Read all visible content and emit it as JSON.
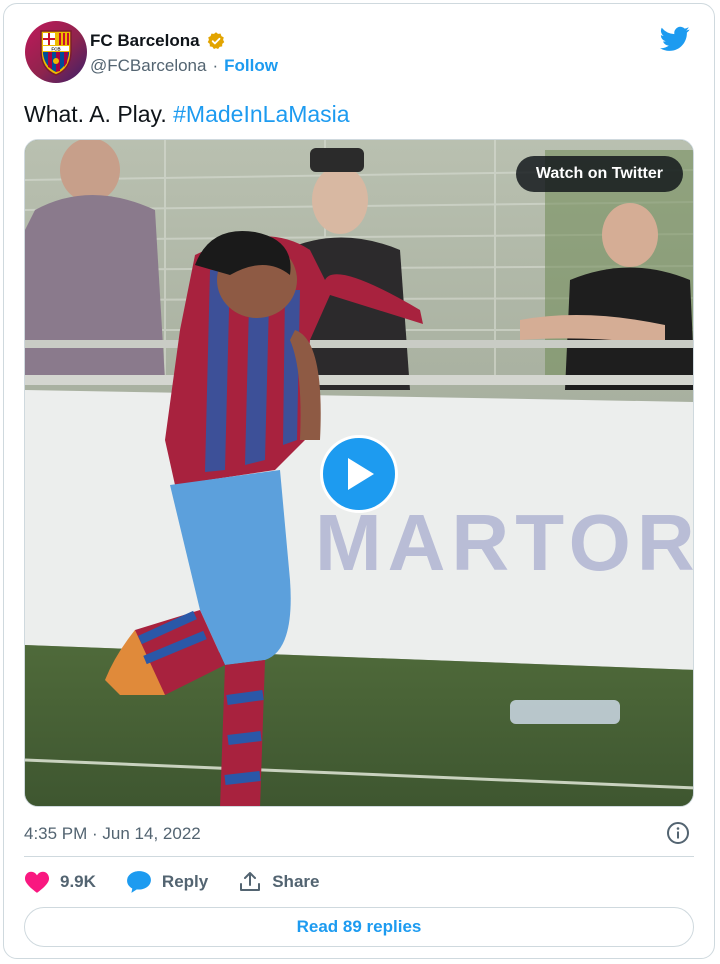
{
  "author": {
    "name": "FC Barcelona",
    "handle": "@FCBarcelona",
    "separator": "·",
    "follow_label": "Follow",
    "avatar_text": "FCB"
  },
  "tweet": {
    "text": "What. A. Play. ",
    "hashtag": "#MadeInLaMasia"
  },
  "media": {
    "watch_label": "Watch on Twitter",
    "banner_text": "MARTOR"
  },
  "meta": {
    "timestamp": "4:35 PM · Jun 14, 2022"
  },
  "actions": {
    "likes": "9.9K",
    "reply_label": "Reply",
    "share_label": "Share",
    "read_replies": "Read 89 replies"
  },
  "colors": {
    "accent": "#1d9bf0",
    "like": "#f91880",
    "text_secondary": "#536471",
    "border": "#cfd9de"
  }
}
